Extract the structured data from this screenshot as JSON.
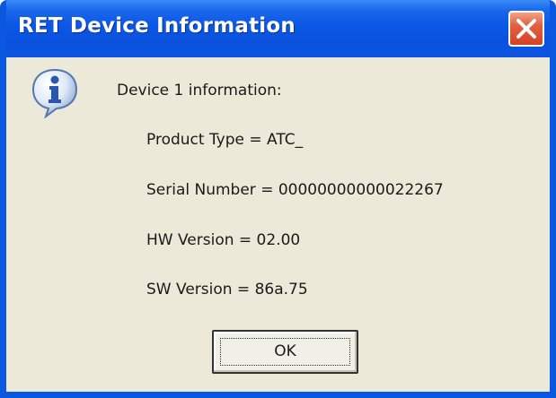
{
  "window": {
    "title": "RET Device Information"
  },
  "dialog": {
    "heading": "Device 1 information:",
    "lines": [
      "Product Type = ATC_",
      "Serial Number = 00000000000022267",
      "HW Version = 02.00",
      "SW Version = 86a.75"
    ],
    "ok_label": "OK",
    "icon": "information-icon"
  },
  "colors": {
    "titlebar": "#0a52de",
    "frame": "#0a58e0",
    "body": "#ece9d8",
    "close_button": "#d64124"
  }
}
